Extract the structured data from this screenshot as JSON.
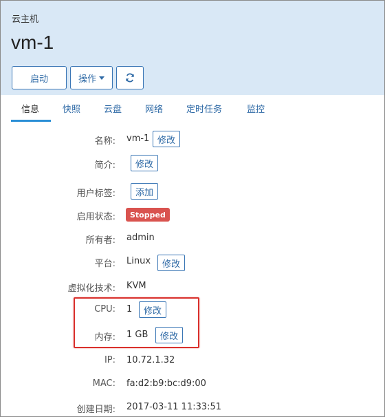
{
  "header": {
    "breadcrumb": "云主机",
    "title": "vm-1",
    "buttons": {
      "start": "启动",
      "operations": "操作",
      "refresh_icon": "refresh-icon"
    }
  },
  "tabs": [
    {
      "label": "信息",
      "active": true
    },
    {
      "label": "快照",
      "active": false
    },
    {
      "label": "云盘",
      "active": false
    },
    {
      "label": "网络",
      "active": false
    },
    {
      "label": "定时任务",
      "active": false
    },
    {
      "label": "监控",
      "active": false
    }
  ],
  "info": {
    "name": {
      "label": "名称:",
      "value": "vm-1",
      "action": "修改"
    },
    "description": {
      "label": "简介:",
      "action": "修改"
    },
    "user_tags": {
      "label": "用户标签:",
      "action": "添加"
    },
    "state": {
      "label": "启用状态:",
      "value": "Stopped",
      "color": "#d9534f"
    },
    "owner": {
      "label": "所有者:",
      "value": "admin"
    },
    "platform": {
      "label": "平台:",
      "value": "Linux",
      "action": "修改"
    },
    "hypervisor": {
      "label": "虚拟化技术:",
      "value": "KVM"
    },
    "cpu": {
      "label": "CPU:",
      "value": "1",
      "action": "修改"
    },
    "memory": {
      "label": "内存:",
      "value": "1 GB",
      "action": "修改"
    },
    "ip": {
      "label": "IP:",
      "value": "10.72.1.32"
    },
    "mac": {
      "label": "MAC:",
      "value": "fa:d2:b9:bc:d9:00"
    },
    "created": {
      "label": "创建日期:",
      "value": "2017-03-11 11:33:51"
    }
  },
  "colors": {
    "header_bg": "#d9e8f6",
    "accent": "#2f6aa6",
    "tab_underline": "#2b8fd6",
    "highlight": "#d9302c"
  }
}
